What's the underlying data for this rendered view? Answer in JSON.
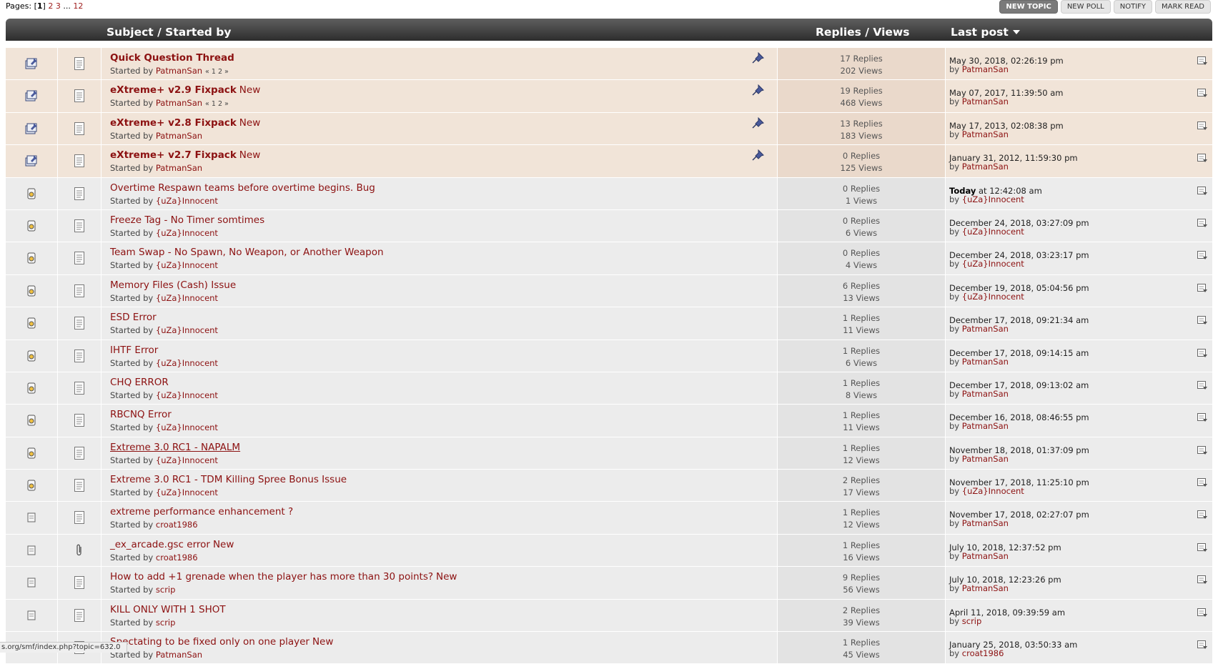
{
  "pagination": {
    "label": "Pages:",
    "current": "1",
    "pages": [
      "2",
      "3"
    ],
    "ellipsis": "...",
    "last": "12"
  },
  "buttons": {
    "new_topic": "NEW TOPIC",
    "new_poll": "NEW POLL",
    "notify": "NOTIFY",
    "mark_read": "MARK READ"
  },
  "header": {
    "subject": "Subject / Started by",
    "replies_views": "Replies / Views",
    "last_post": "Last post"
  },
  "labels": {
    "started_by": "Started by",
    "by": "by"
  },
  "topics": [
    {
      "title": "Quick Question Thread",
      "new": "",
      "starter": "PatmanSan",
      "pages": "« 1 2 »",
      "replies": "17 Replies",
      "views": "202 Views",
      "last_date": "May 30, 2018, 02:26:19 pm",
      "last_today": "",
      "last_by": "PatmanSan"
    },
    {
      "title": "eXtreme+ v2.9 Fixpack",
      "new": "New",
      "starter": "PatmanSan",
      "pages": "« 1 2 »",
      "replies": "19 Replies",
      "views": "468 Views",
      "last_date": "May 07, 2017, 11:39:50 am",
      "last_today": "",
      "last_by": "PatmanSan"
    },
    {
      "title": "eXtreme+ v2.8 Fixpack",
      "new": "New",
      "starter": "PatmanSan",
      "pages": "",
      "replies": "13 Replies",
      "views": "183 Views",
      "last_date": "May 17, 2013, 02:08:38 pm",
      "last_today": "",
      "last_by": "PatmanSan"
    },
    {
      "title": "eXtreme+ v2.7 Fixpack",
      "new": "New",
      "starter": "PatmanSan",
      "pages": "",
      "replies": "0 Replies",
      "views": "125 Views",
      "last_date": "January 31, 2012, 11:59:30 pm",
      "last_today": "",
      "last_by": "PatmanSan"
    },
    {
      "title": "Overtime Respawn teams before overtime begins. Bug",
      "new": "",
      "starter": "{uZa}Innocent",
      "pages": "",
      "replies": "0 Replies",
      "views": "1 Views",
      "last_date": " at 12:42:08 am",
      "last_today": "Today",
      "last_by": "{uZa}Innocent"
    },
    {
      "title": "Freeze Tag - No Timer somtimes",
      "new": "",
      "starter": "{uZa}Innocent",
      "pages": "",
      "replies": "0 Replies",
      "views": "6 Views",
      "last_date": "December 24, 2018, 03:27:09 pm",
      "last_today": "",
      "last_by": "{uZa}Innocent"
    },
    {
      "title": "Team Swap - No Spawn, No Weapon, or Another Weapon",
      "new": "",
      "starter": "{uZa}Innocent",
      "pages": "",
      "replies": "0 Replies",
      "views": "4 Views",
      "last_date": "December 24, 2018, 03:23:17 pm",
      "last_today": "",
      "last_by": "{uZa}Innocent"
    },
    {
      "title": "Memory Files (Cash) Issue",
      "new": "",
      "starter": "{uZa}Innocent",
      "pages": "",
      "replies": "6 Replies",
      "views": "13 Views",
      "last_date": "December 19, 2018, 05:04:56 pm",
      "last_today": "",
      "last_by": "{uZa}Innocent"
    },
    {
      "title": "ESD Error",
      "new": "",
      "starter": "{uZa}Innocent",
      "pages": "",
      "replies": "1 Replies",
      "views": "11 Views",
      "last_date": "December 17, 2018, 09:21:34 am",
      "last_today": "",
      "last_by": "PatmanSan"
    },
    {
      "title": "IHTF Error",
      "new": "",
      "starter": "{uZa}Innocent",
      "pages": "",
      "replies": "1 Replies",
      "views": "6 Views",
      "last_date": "December 17, 2018, 09:14:15 am",
      "last_today": "",
      "last_by": "PatmanSan"
    },
    {
      "title": "CHQ ERROR",
      "new": "",
      "starter": "{uZa}Innocent",
      "pages": "",
      "replies": "1 Replies",
      "views": "8 Views",
      "last_date": "December 17, 2018, 09:13:02 am",
      "last_today": "",
      "last_by": "PatmanSan"
    },
    {
      "title": "RBCNQ Error",
      "new": "",
      "starter": "{uZa}Innocent",
      "pages": "",
      "replies": "1 Replies",
      "views": "11 Views",
      "last_date": "December 16, 2018, 08:46:55 pm",
      "last_today": "",
      "last_by": "PatmanSan"
    },
    {
      "title": "Extreme 3.0 RC1 - NAPALM",
      "new": "",
      "starter": "{uZa}Innocent",
      "pages": "",
      "replies": "1 Replies",
      "views": "12 Views",
      "last_date": "November 18, 2018, 01:37:09 pm",
      "last_today": "",
      "last_by": "PatmanSan"
    },
    {
      "title": "Extreme 3.0 RC1 - TDM Killing Spree Bonus Issue",
      "new": "",
      "starter": "{uZa}Innocent",
      "pages": "",
      "replies": "2 Replies",
      "views": "17 Views",
      "last_date": "November 17, 2018, 11:25:10 pm",
      "last_today": "",
      "last_by": "{uZa}Innocent"
    },
    {
      "title": "extreme performance enhancement ?",
      "new": "",
      "starter": "croat1986",
      "pages": "",
      "replies": "1 Replies",
      "views": "12 Views",
      "last_date": "November 17, 2018, 02:27:07 pm",
      "last_today": "",
      "last_by": "PatmanSan"
    },
    {
      "title": "_ex_arcade.gsc error",
      "new": "New",
      "starter": "croat1986",
      "pages": "",
      "replies": "1 Replies",
      "views": "16 Views",
      "last_date": "July 10, 2018, 12:37:52 pm",
      "last_today": "",
      "last_by": "PatmanSan"
    },
    {
      "title": "How to add +1 grenade when the player has more than 30 points?",
      "new": "New",
      "starter": "scrip",
      "pages": "",
      "replies": "9 Replies",
      "views": "56 Views",
      "last_date": "July 10, 2018, 12:23:26 pm",
      "last_today": "",
      "last_by": "PatmanSan"
    },
    {
      "title": "KILL ONLY WITH 1 SHOT",
      "new": "",
      "starter": "scrip",
      "pages": "",
      "replies": "2 Replies",
      "views": "39 Views",
      "last_date": "April 11, 2018, 09:39:59 am",
      "last_today": "",
      "last_by": "scrip"
    },
    {
      "title": "Spectating to be fixed only on one player",
      "new": "New",
      "starter": "PatmanSan",
      "pages": "",
      "replies": "1 Replies",
      "views": "45 Views",
      "last_date": "January 25, 2018, 03:50:33 am",
      "last_today": "",
      "last_by": "croat1986"
    }
  ],
  "statusbar": {
    "url": "s.org/smf/index.php?topic=632.0"
  },
  "colors": {
    "accent": "#8c1111",
    "sticky_bg": "#f1e4d8",
    "normal_bg": "#ececec",
    "header_bg": "#3c3c3c"
  }
}
